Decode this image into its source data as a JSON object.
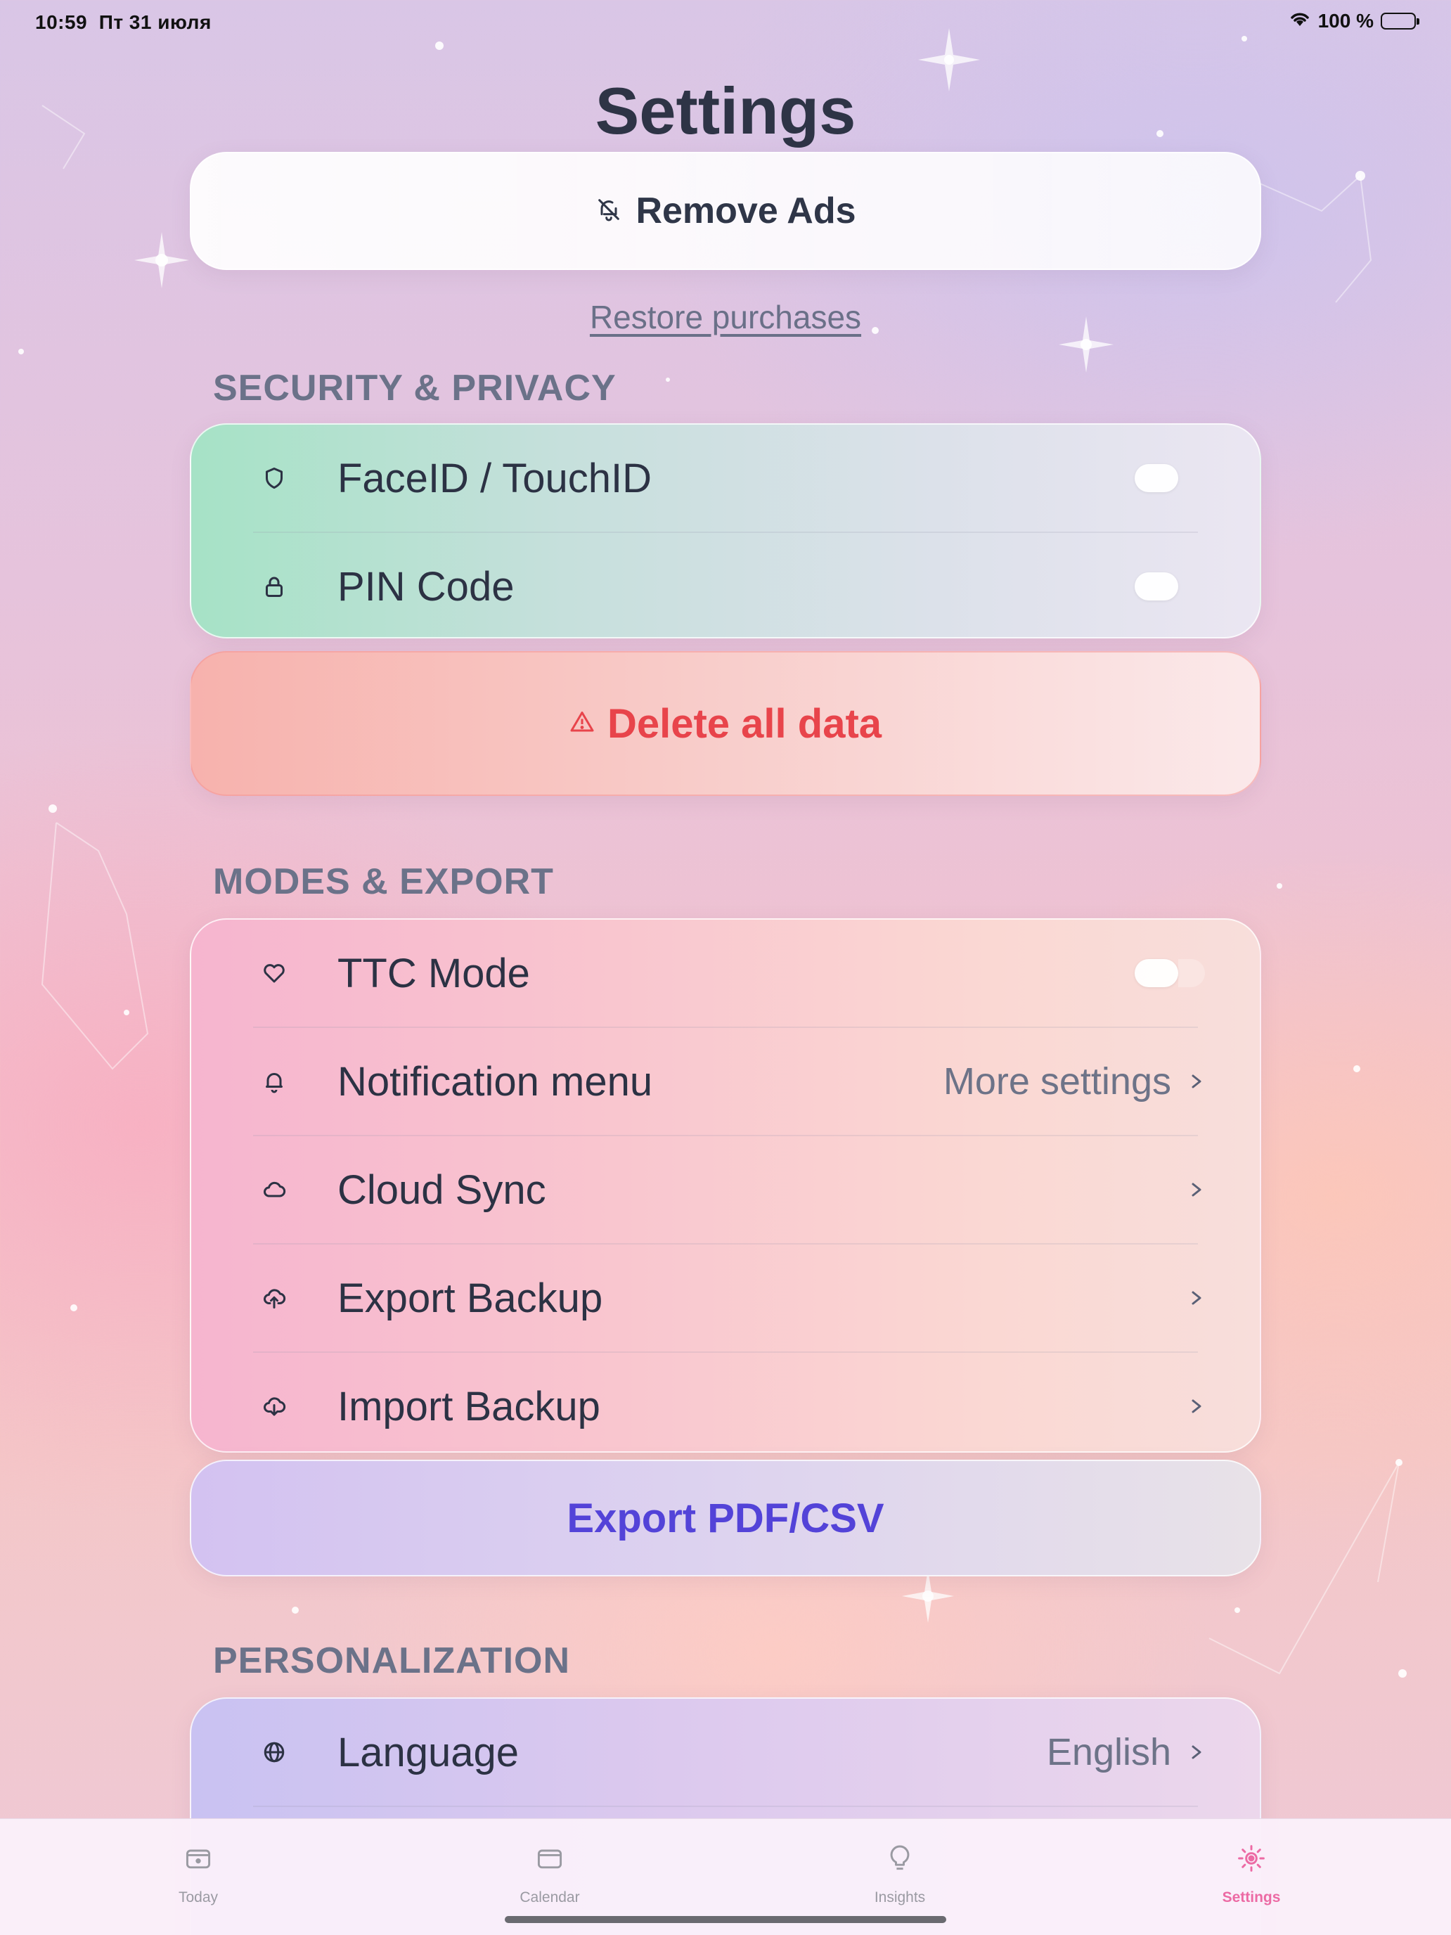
{
  "status_bar": {
    "time": "10:59",
    "date": "Пт 31 июля",
    "battery": "100 %"
  },
  "title": "Settings",
  "remove_ads": {
    "label": "Remove Ads",
    "icon": "bell-slash-icon"
  },
  "restore_purchases": "Restore purchases",
  "sections": {
    "security": {
      "header": "SECURITY & PRIVACY",
      "rows": [
        {
          "label": "FaceID / TouchID",
          "icon": "shield-icon",
          "control": "toggle",
          "on": false
        },
        {
          "label": "PIN Code",
          "icon": "lock-icon",
          "control": "toggle",
          "on": false
        }
      ]
    },
    "delete_all": {
      "label": "Delete all data",
      "icon": "warning-triangle-icon",
      "color": "#e8444b"
    },
    "modes": {
      "header": "MODES & EXPORT",
      "rows": [
        {
          "label": "TTC Mode",
          "icon": "heart-icon",
          "control": "toggle",
          "on": false
        },
        {
          "label": "Notification menu",
          "icon": "bell-icon",
          "value": "More settings",
          "control": "chevron"
        },
        {
          "label": "Cloud Sync",
          "icon": "cloud-icon",
          "control": "chevron"
        },
        {
          "label": "Export Backup",
          "icon": "cloud-upload-icon",
          "control": "chevron"
        },
        {
          "label": "Import Backup",
          "icon": "cloud-download-icon",
          "control": "chevron"
        }
      ]
    },
    "export_pdf": {
      "label": "Export PDF/CSV",
      "color": "#5343d8"
    },
    "personalization": {
      "header": "PERSONALIZATION",
      "rows": [
        {
          "label": "Language",
          "icon": "globe-icon",
          "value": "English",
          "control": "chevron"
        }
      ]
    }
  },
  "tab_bar": {
    "tabs": [
      {
        "label": "Today",
        "icon": "today-icon",
        "active": false
      },
      {
        "label": "Calendar",
        "icon": "calendar-icon",
        "active": false
      },
      {
        "label": "Insights",
        "icon": "lightbulb-icon",
        "active": false
      },
      {
        "label": "Settings",
        "icon": "sun-gear-icon",
        "active": true
      }
    ],
    "active_color": "#ec6aa4"
  }
}
